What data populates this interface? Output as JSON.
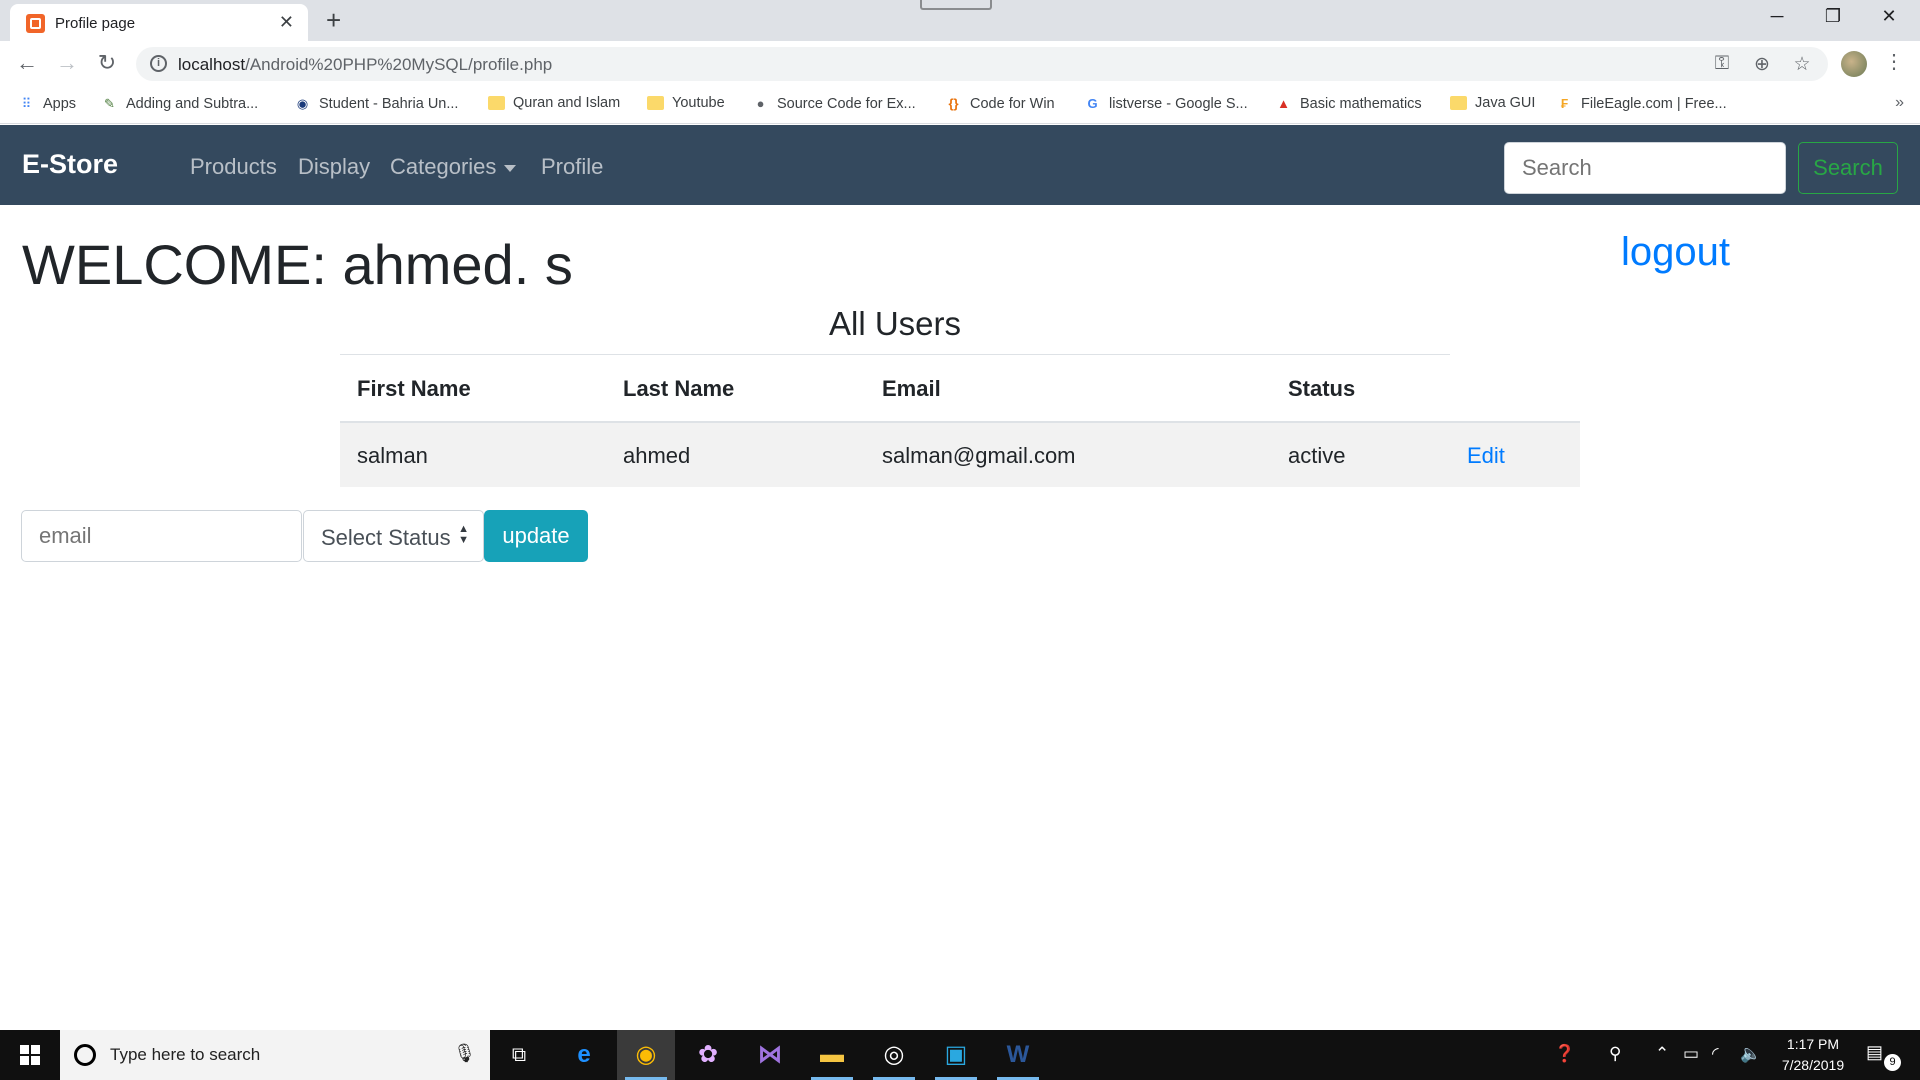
{
  "browser": {
    "tab_title": "Profile page",
    "tab_close": "✕",
    "new_tab": "+",
    "window_controls": {
      "minimize": "─",
      "maximize": "❐",
      "close": "✕"
    },
    "url_host": "localhost",
    "url_path": "/Android%20PHP%20MySQL/profile.php",
    "bookmarks": [
      {
        "label": "Apps",
        "icon": "apps-grid-icon"
      },
      {
        "label": "Adding and Subtra...",
        "icon": "site-icon"
      },
      {
        "label": "Student - Bahria Un...",
        "icon": "site-icon"
      },
      {
        "label": "Quran and Islam",
        "icon": "folder-icon"
      },
      {
        "label": "Youtube",
        "icon": "folder-icon"
      },
      {
        "label": "Source Code for Ex...",
        "icon": "globe-icon"
      },
      {
        "label": "Code for Win",
        "icon": "braces-icon"
      },
      {
        "label": "listverse - Google S...",
        "icon": "google-icon"
      },
      {
        "label": "Basic mathematics",
        "icon": "triangle-icon"
      },
      {
        "label": "Java GUI",
        "icon": "folder-icon"
      },
      {
        "label": "FileEagle.com | Free...",
        "icon": "site-icon"
      }
    ],
    "bookmarks_more": "»"
  },
  "navbar": {
    "brand": "E-Store",
    "links": [
      "Products",
      "Display",
      "Categories",
      "Profile"
    ],
    "search_placeholder": "Search",
    "search_button": "Search"
  },
  "main": {
    "welcome": "WELCOME: ahmed. s",
    "logout": "logout",
    "table_title": "All Users",
    "columns": [
      "First Name",
      "Last Name",
      "Email",
      "Status"
    ],
    "rows": [
      {
        "first_name": "salman",
        "last_name": "ahmed",
        "email": "salman@gmail.com",
        "status": "active",
        "action": "Edit"
      }
    ]
  },
  "update_form": {
    "email_placeholder": "email",
    "status_selected": "Select Status",
    "submit": "update"
  },
  "taskbar": {
    "search_placeholder": "Type here to search",
    "time": "1:17 PM",
    "date": "7/28/2019",
    "notification_count": "9"
  },
  "colors": {
    "navbar_bg": "#34495e",
    "link_blue": "#007bff",
    "search_green": "#28a745",
    "update_teal": "#17a2b8"
  }
}
